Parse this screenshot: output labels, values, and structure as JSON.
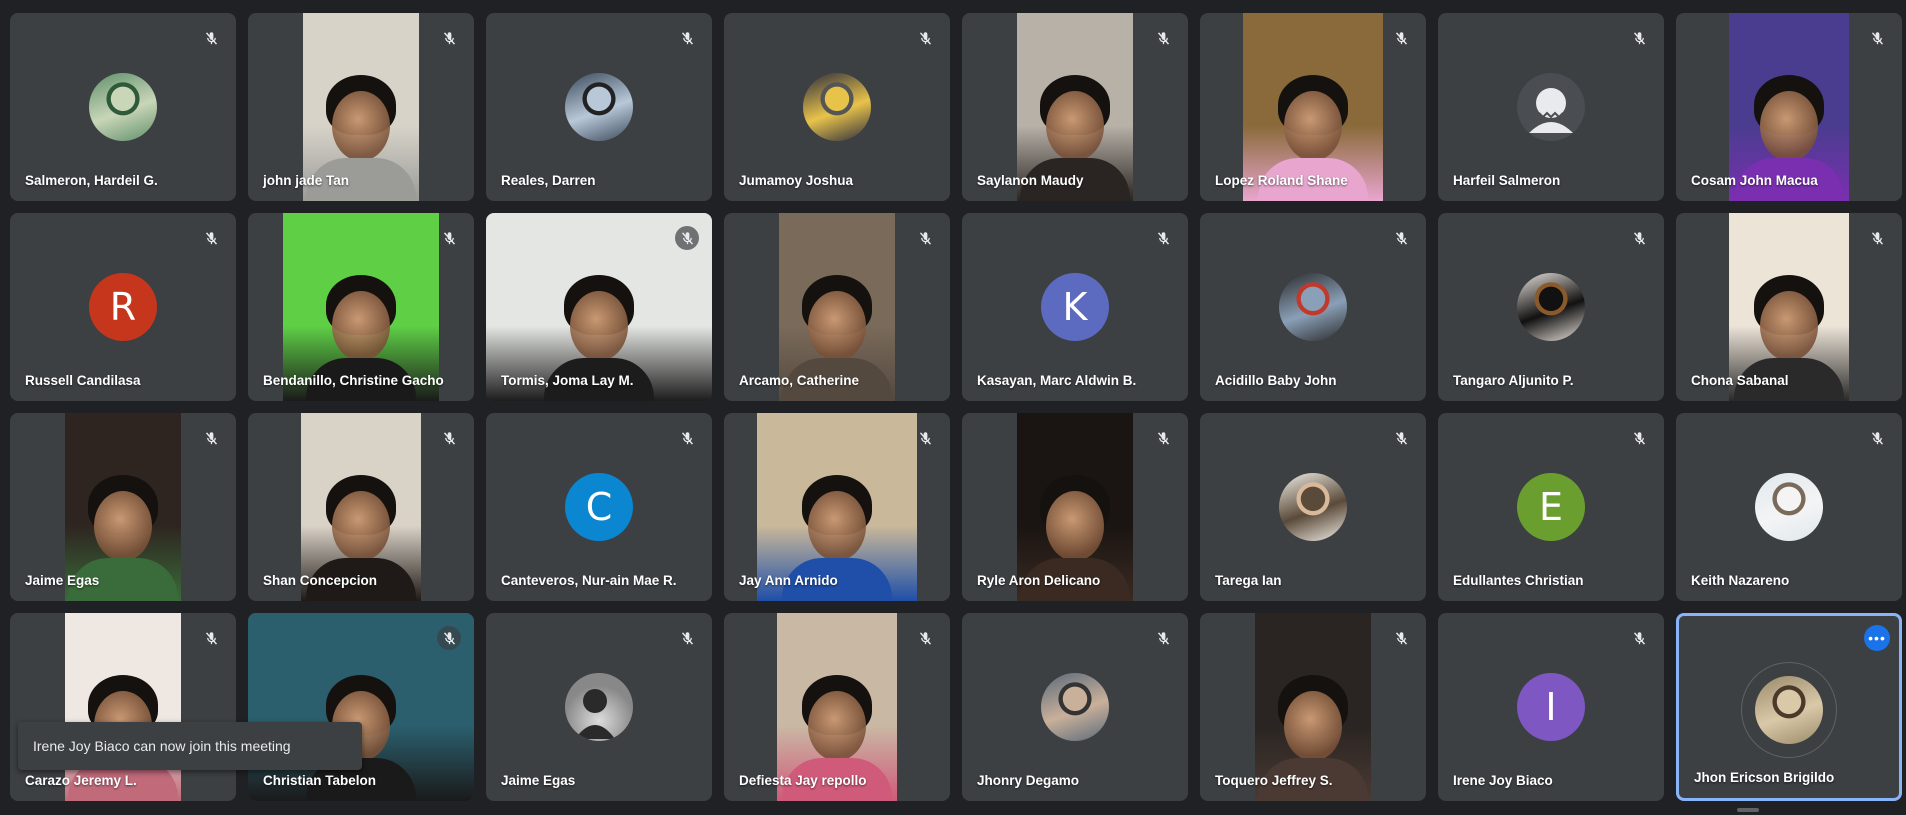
{
  "participants": [
    {
      "name": "Salmeron, Hardeil G.",
      "kind": "avatar-photo",
      "colors": [
        "#5f8f6a",
        "#c9d6b8",
        "#2f5a3a"
      ]
    },
    {
      "name": "john jade Tan",
      "kind": "video",
      "bg": "#d7d3c9",
      "shirt": "#9b9b98",
      "width": 116
    },
    {
      "name": "Reales, Darren",
      "kind": "avatar-photo",
      "colors": [
        "#3a4a5a",
        "#b9c8d8",
        "#222"
      ]
    },
    {
      "name": "Jumamoy Joshua",
      "kind": "avatar-photo",
      "colors": [
        "#2c2c3e",
        "#e8c34a",
        "#555"
      ]
    },
    {
      "name": "Saylanon Maudy",
      "kind": "video",
      "bg": "#b7b1a8",
      "shirt": "#2a2522",
      "width": 116
    },
    {
      "name": "Lopez Roland Shane",
      "kind": "video",
      "bg": "#8a6a3a",
      "shirt": "#e8a6cf",
      "width": 140,
      "dark": true
    },
    {
      "name": "Harfeil Salmeron",
      "kind": "default-avatar"
    },
    {
      "name": "Cosam John Macua",
      "kind": "video",
      "bg": "#4a3d8f",
      "shirt": "#7a2fb0",
      "width": 120
    },
    {
      "name": "Russell Candilasa",
      "kind": "letter",
      "letter": "R",
      "color": "#c5361c"
    },
    {
      "name": "Bendanillo, Christine Gacho",
      "kind": "video",
      "bg": "#5fd046",
      "shirt": "#1a1a1a",
      "width": 156
    },
    {
      "name": "Tormis, Joma Lay M.",
      "kind": "video",
      "bg": "#e4e6e3",
      "shirt": "#1c1c1c",
      "width": 226,
      "wide": true
    },
    {
      "name": "Arcamo, Catherine",
      "kind": "video",
      "bg": "#7a6a5a",
      "shirt": "#54493f",
      "width": 116
    },
    {
      "name": "Kasayan, Marc Aldwin B.",
      "kind": "letter",
      "letter": "K",
      "color": "#5c6bc0"
    },
    {
      "name": "Acidillo Baby John",
      "kind": "avatar-photo",
      "colors": [
        "#2b2b2b",
        "#8aa0b8",
        "#c0392b"
      ]
    },
    {
      "name": "Tangaro Aljunito P.",
      "kind": "avatar-photo",
      "colors": [
        "#e9e2dc",
        "#111",
        "#8b5a2b"
      ]
    },
    {
      "name": "Chona Sabanal",
      "kind": "video",
      "bg": "#ede4d8",
      "shirt": "#2a2a2a",
      "width": 120
    },
    {
      "name": "Jaime Egas",
      "kind": "video",
      "bg": "#2e2520",
      "shirt": "#3a6b3a",
      "width": 116,
      "dark": true
    },
    {
      "name": "Shan Concepcion",
      "kind": "video",
      "bg": "#d9d2c7",
      "shirt": "#1f1a17",
      "width": 120
    },
    {
      "name": "Canteveros, Nur-ain Mae R.",
      "kind": "letter",
      "letter": "C",
      "color": "#0b86d1"
    },
    {
      "name": "Jay Ann Arnido",
      "kind": "video",
      "bg": "#c9b89a",
      "shirt": "#1f4fa8",
      "width": 160
    },
    {
      "name": "Ryle Aron Delicano",
      "kind": "video",
      "bg": "#1a1512",
      "shirt": "#3a2a22",
      "width": 116,
      "dark": true
    },
    {
      "name": "Tarega Ian",
      "kind": "avatar-photo",
      "colors": [
        "#f1ede4",
        "#5a4a3a",
        "#d9b99a"
      ]
    },
    {
      "name": "Edullantes Christian",
      "kind": "letter",
      "letter": "E",
      "color": "#6a9f2f"
    },
    {
      "name": "Keith Nazareno",
      "kind": "avatar-photo",
      "colors": [
        "#dfe8ee",
        "#f4f4f4",
        "#7a6a5a"
      ]
    },
    {
      "name": "Carazo Jeremy L.",
      "kind": "video",
      "bg": "#efe8e2",
      "shirt": "#c06a7a",
      "width": 116
    },
    {
      "name": "Christian Tabelon",
      "kind": "video",
      "bg": "#2b5f6e",
      "shirt": "#1a1a1a",
      "width": 226,
      "wide": true
    },
    {
      "name": "Jaime Egas",
      "kind": "default-avatar-photo"
    },
    {
      "name": "Defiesta Jay repollo",
      "kind": "video",
      "bg": "#c9b8a4",
      "shirt": "#d05a7a",
      "width": 120
    },
    {
      "name": "Jhonry Degamo",
      "kind": "avatar-photo",
      "colors": [
        "#5a6a7a",
        "#c9b09a",
        "#333"
      ]
    },
    {
      "name": "Toquero Jeffrey S.",
      "kind": "video",
      "bg": "#2a2522",
      "shirt": "#4a3a33",
      "width": 116,
      "dark": true
    },
    {
      "name": "Irene Joy Biaco",
      "kind": "letter",
      "letter": "I",
      "color": "#7e57c2"
    },
    {
      "name": "Jhon Ericson Brigildo",
      "kind": "avatar-photo",
      "colors": [
        "#9a8a6a",
        "#d9c9a9",
        "#4a3a2a"
      ],
      "active": true
    }
  ],
  "toast": {
    "message": "Irene Joy Biaco can now join this meeting"
  },
  "icons": {
    "muted": "mic-off-icon",
    "more": "more-options-icon"
  },
  "colors": {
    "background": "#202124",
    "tile": "#3c4043",
    "active_border": "#8ab4f8",
    "accent": "#1a73e8"
  }
}
